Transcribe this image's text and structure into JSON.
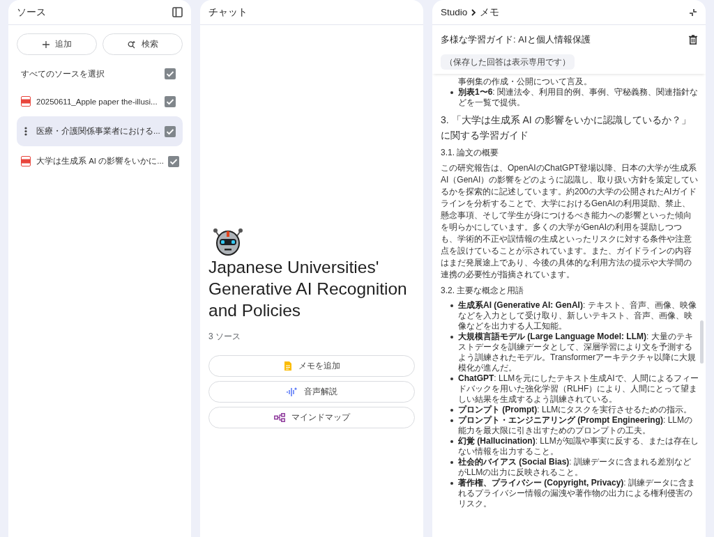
{
  "sources_panel": {
    "title": "ソース",
    "add_button": "追加",
    "search_button": "検索",
    "select_all": {
      "label": "すべてのソースを選択",
      "checked": true
    },
    "sources": [
      {
        "title": "20250611_Apple paper the-illusi...",
        "kind": "pdf",
        "selected": false,
        "checked": true
      },
      {
        "title": "医療・介護関係事業者における...",
        "kind": "menu",
        "selected": true,
        "checked": true
      },
      {
        "title": "大学は生成系 AI の影響をいかに...",
        "kind": "pdf",
        "selected": false,
        "checked": true
      }
    ]
  },
  "chat_panel": {
    "title": "チャット",
    "notebook_title": "Japanese Universities' Generative AI Recognition and Policies",
    "source_count": "3 ソース",
    "actions": [
      {
        "label": "メモを追加",
        "kind": "note"
      },
      {
        "label": "音声解説",
        "kind": "audio"
      },
      {
        "label": "マインドマップ",
        "kind": "mindmap"
      }
    ]
  },
  "studio_panel": {
    "breadcrumb": [
      "Studio",
      "メモ"
    ],
    "note_title": "多様な学習ガイド: AIと個人情報保護",
    "notice": "（保存した回答は表示専用です）",
    "blocks": [
      {
        "kind": "continuation",
        "text": "事例集の作成・公開について言及。"
      },
      {
        "kind": "bullet",
        "text": "**別表1〜6**: 関連法令、利用目的例、事例、守秘義務、関連指針などを一覧で提供。"
      },
      {
        "kind": "heading",
        "text": "3. 「大学は生成系 AI の影響をいかに認識しているか？」に関する学習ガイド"
      },
      {
        "kind": "subheading",
        "text": "3.1. 論文の概要"
      },
      {
        "kind": "paragraph",
        "text": "この研究報告は、OpenAIのChatGPT登場以降、日本の大学が生成系AI（GenAI）の影響をどのように認識し、取り扱い方針を策定しているかを探索的に記述しています。約200の大学の公開されたAIガイドラインを分析することで、大学におけるGenAIの利用奨励、禁止、懸念事項、そして学生が身につけるべき能力への影響といった傾向を明らかにしています。多くの大学がGenAIの利用を奨励しつつも、学術的不正や誤情報の生成といったリスクに対する条件や注意点を設けていることが示されています。また、ガイドラインの内容はまだ発展途上であり、今後の具体的な利用方法の提示や大学間の連携の必要性が指摘されています。"
      },
      {
        "kind": "subheading",
        "text": "3.2. 主要な概念と用語"
      },
      {
        "kind": "bullet",
        "text": "**生成系AI (Generative AI: GenAI)**: テキスト、音声、画像、映像などを入力として受け取り、新しいテキスト、音声、画像、映像などを出力する人工知能。"
      },
      {
        "kind": "bullet",
        "text": "**大規模言語モデル (Large Language Model: LLM)**: 大量のテキストデータを訓練データとして、深層学習により文を予測するよう訓練されたモデル。Transformerアーキテクチャ以降に大規模化が進んだ。"
      },
      {
        "kind": "bullet",
        "text": "**ChatGPT**: LLMを元にしたテキスト生成AIで、人間によるフィードバックを用いた強化学習（RLHF）により、人間にとって望ましい結果を生成するよう訓練されている。"
      },
      {
        "kind": "bullet",
        "text": "**プロンプト (Prompt)**: LLMにタスクを実行させるための指示。"
      },
      {
        "kind": "bullet",
        "text": "**プロンプト・エンジニアリング (Prompt Engineering)**: LLMの能力を最大限に引き出すためのプロンプトの工夫。"
      },
      {
        "kind": "bullet",
        "text": "**幻覚 (Hallucination)**: LLMが知識や事実に反する、または存在しない情報を出力すること。"
      },
      {
        "kind": "bullet",
        "text": "**社会的バイアス (Social Bias)**: 訓練データに含まれる差別などがLLMの出力に反映されること。"
      },
      {
        "kind": "bullet",
        "text": "**著作権、プライバシー (Copyright, Privacy)**: 訓練データに含まれるプライバシー情報の漏洩や著作物の出力による権利侵害のリスク。"
      }
    ]
  }
}
